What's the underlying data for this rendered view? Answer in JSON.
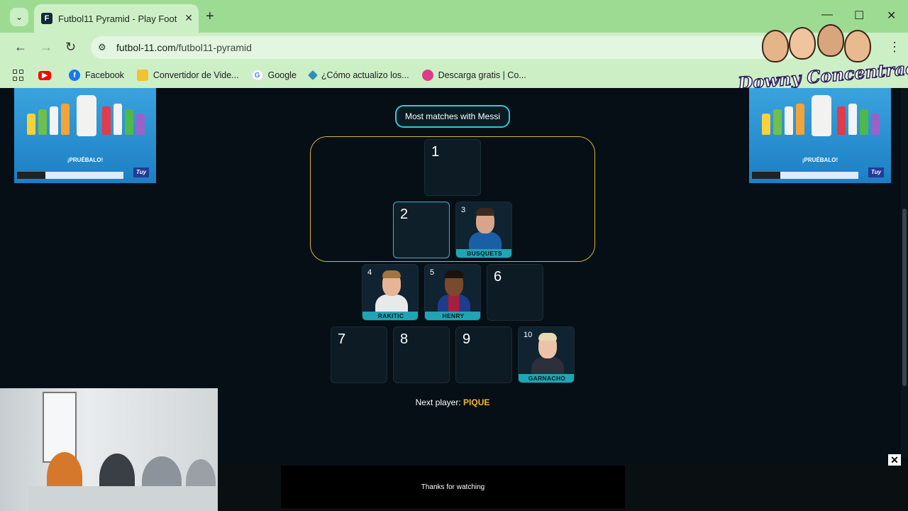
{
  "browser": {
    "tab_title": "Futbol11 Pyramid - Play Footba",
    "url_domain": "futbol-11.com",
    "url_path": "/futbol11-pyramid",
    "bookmarks": [
      "Facebook",
      "Convertidor de Vide...",
      "Google",
      "¿Cómo actualizo los...",
      "Descarga gratis | Co..."
    ]
  },
  "overlay": {
    "logo_text": "Downy Concentrao"
  },
  "ads": {
    "slogan": "¡PRUÉBALO!",
    "brand": "Tuy"
  },
  "game": {
    "title": "Most matches with Messi",
    "slots": {
      "s1": {
        "num": "1"
      },
      "s2": {
        "num": "2"
      },
      "s3": {
        "num": "3",
        "player": "BUSQUETS"
      },
      "s4": {
        "num": "4",
        "player": "RAKITIC"
      },
      "s5": {
        "num": "5",
        "player": "HENRY"
      },
      "s6": {
        "num": "6"
      },
      "s7": {
        "num": "7"
      },
      "s8": {
        "num": "8"
      },
      "s9": {
        "num": "9"
      },
      "s10": {
        "num": "10",
        "player": "GARNACHO"
      }
    },
    "next_label": "Next player:",
    "next_player": "PIQUE"
  },
  "video_ad": {
    "text": "Thanks for watching"
  },
  "colors": {
    "accent_gold": "#f5b731",
    "accent_cyan": "#38c7d9",
    "frame_gold": "#d9b23c",
    "chrome_green": "#a8e3a0"
  }
}
